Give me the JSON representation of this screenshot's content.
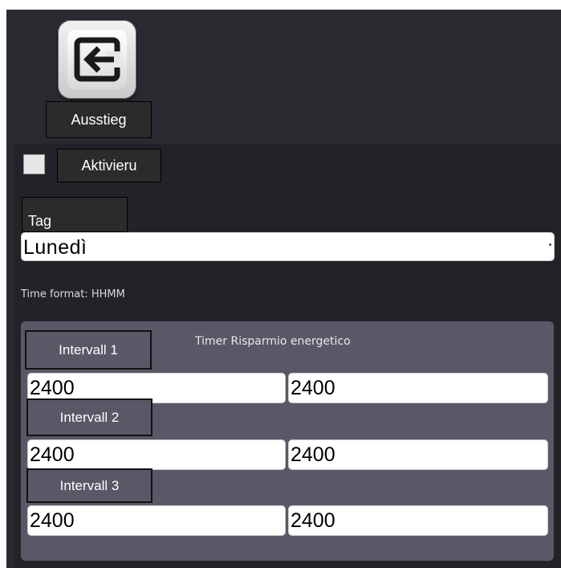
{
  "header": {
    "exit_icon": "exit-arrow-icon",
    "exit_label": "Ausstieg"
  },
  "activation": {
    "checked": false,
    "label": "Aktivieru"
  },
  "day": {
    "label": "Tag",
    "selected": "Lunedì"
  },
  "time_format": "Time format: HHMM",
  "timer": {
    "title": "Timer Risparmio energetico",
    "intervals": [
      {
        "label": "Intervall 1",
        "start": "2400",
        "end": "2400"
      },
      {
        "label": "Intervall 2",
        "start": "2400",
        "end": "2400"
      },
      {
        "label": "Intervall 3",
        "start": "2400",
        "end": "2400"
      }
    ]
  },
  "colors": {
    "background": "#2b2930",
    "panel": "#242229",
    "timer_panel": "#5a5866",
    "label_box": "#2b2b2b"
  }
}
